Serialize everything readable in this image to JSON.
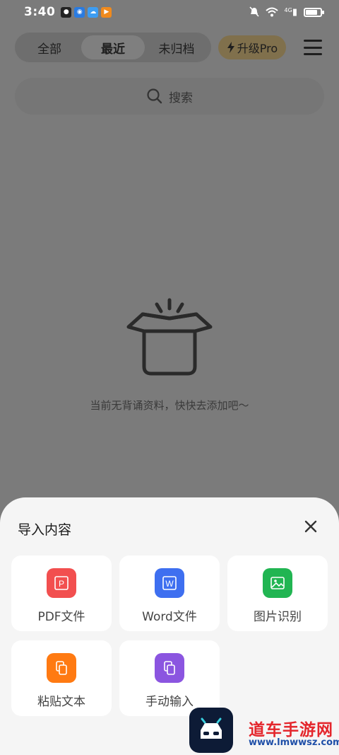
{
  "status_bar": {
    "time": "3:40",
    "network_badge": "4G"
  },
  "top_bar": {
    "tabs": [
      {
        "label": "全部",
        "active": false
      },
      {
        "label": "最近",
        "active": true
      },
      {
        "label": "未归档",
        "active": false
      }
    ],
    "upgrade_label": "升级Pro"
  },
  "search": {
    "placeholder": "搜索"
  },
  "empty_state": {
    "message": "当前无背诵资料，快快去添加吧～"
  },
  "import_sheet": {
    "title": "导入内容",
    "options": [
      {
        "label": "PDF文件",
        "icon": "pdf-icon",
        "color": "#f24f4f"
      },
      {
        "label": "Word文件",
        "icon": "word-icon",
        "color": "#3e6ff0"
      },
      {
        "label": "图片识别",
        "icon": "image-icon",
        "color": "#21b552"
      },
      {
        "label": "粘贴文本",
        "icon": "paste-icon",
        "color": "#ff7a12"
      },
      {
        "label": "手动输入",
        "icon": "manual-input-icon",
        "color": "#8b55e0"
      }
    ]
  },
  "watermark": {
    "text": "道车手游网",
    "url": "www.lmwwsz.com"
  },
  "colors": {
    "overlay": "#7b7b7b",
    "sheet_bg": "#f5f5f5",
    "pro_badge": "#80704c"
  }
}
